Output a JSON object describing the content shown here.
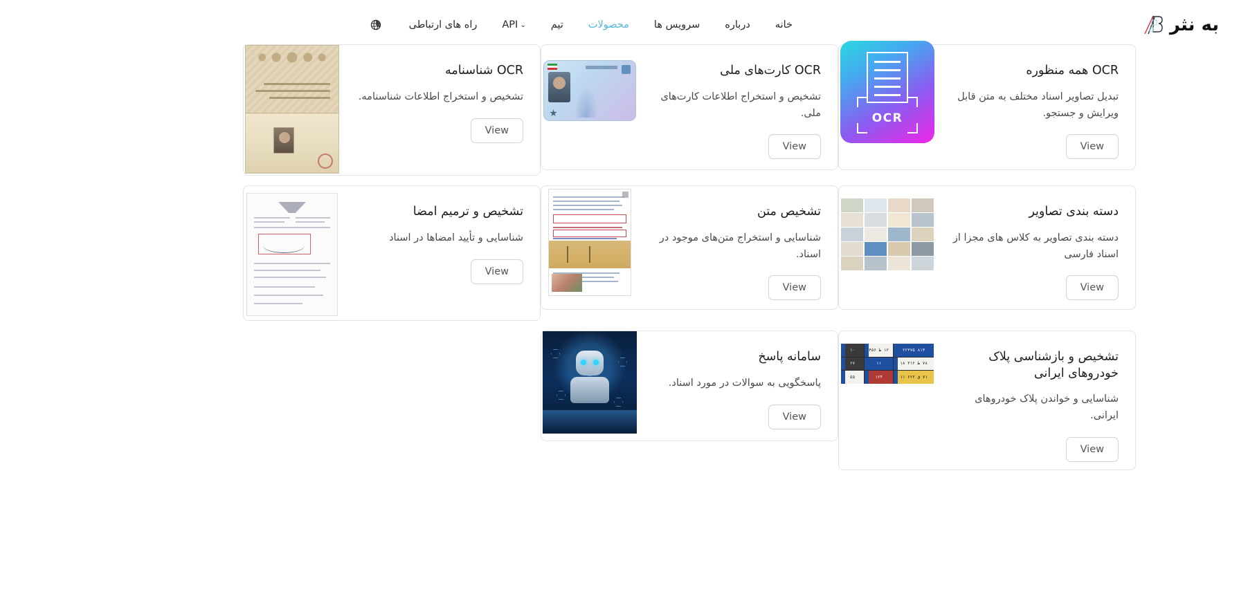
{
  "header": {
    "brand_name": "به نثر",
    "brand_mark": "AB-monogram-logo",
    "nav_items": [
      {
        "label": "خانه",
        "active": false,
        "has_caret": false,
        "name": "home"
      },
      {
        "label": "درباره",
        "active": false,
        "has_caret": false,
        "name": "about"
      },
      {
        "label": "سرویس ها",
        "active": false,
        "has_caret": false,
        "name": "services"
      },
      {
        "label": "محصولات",
        "active": true,
        "has_caret": false,
        "name": "products"
      },
      {
        "label": "تیم",
        "active": false,
        "has_caret": false,
        "name": "team"
      },
      {
        "label": "API",
        "active": false,
        "has_caret": true,
        "name": "api"
      },
      {
        "label": "راه های ارتباطی",
        "active": false,
        "has_caret": false,
        "name": "contact"
      }
    ],
    "caret_glyph": "⌄",
    "language_icon": "globe-icon"
  },
  "colors": {
    "accent": "#52b6d8",
    "text": "#1d1d1d",
    "muted": "#4a4a4a",
    "card_border": "#e4e4e4",
    "button_border": "#d4d4d4",
    "page_background": "#ffffff"
  },
  "common": {
    "view_label": "View"
  },
  "products": [
    {
      "id": "multipurpose-ocr",
      "title": "OCR همه منظوره",
      "description": "تبدیل تصاویر اسناد مختلف به متن قابل ویرایش و جستجو.",
      "button": "View",
      "image_name": "ocr-gradient-tile-thumbnail",
      "row": 1
    },
    {
      "id": "national-card-ocr",
      "title": "OCR کارت‌های ملی",
      "description": "تشخیص و استخراج اطلاعات کارت‌های ملی.",
      "button": "View",
      "image_name": "national-id-card-thumbnail",
      "row": 1
    },
    {
      "id": "birth-certificate-ocr",
      "title": "OCR شناسنامه",
      "description": "تشخیص و استخراج اطلاعات شناسنامه.",
      "button": "View",
      "image_name": "birth-certificate-thumbnail",
      "row": 1
    },
    {
      "id": "image-classification",
      "title": "دسته بندی تصاویر",
      "description": "دسته بندی تصاویر به کلاس های مجزا از اسناد فارسی",
      "button": "View",
      "image_name": "document-image-grid-thumbnail",
      "row": 2
    },
    {
      "id": "text-recognition",
      "title": "تشخیص متن",
      "description": "شناسایی و استخراج متن‌های موجود در اسناد.",
      "button": "View",
      "image_name": "annotated-text-document-thumbnail",
      "row": 2
    },
    {
      "id": "signature-detection",
      "title": "تشخیص و ترمیم امضا",
      "description": "شناسایی و تأیید امضاها در اسناد",
      "button": "View",
      "image_name": "signature-form-thumbnail",
      "row": 2
    },
    {
      "id": "license-plate-recognition",
      "title": "تشخیص و بازشناسی پلاک خودروهای ایرانی",
      "description": "شناسایی و خواندن پلاک خودروهای ایرانی.",
      "button": "View",
      "image_name": "iranian-license-plates-thumbnail",
      "row": 3
    },
    {
      "id": "answer-system",
      "title": "سامانه پاسخ",
      "description": "پاسخگویی به سوالات در مورد اسناد.",
      "button": "View",
      "image_name": "ai-robot-thumbnail",
      "row": 3
    }
  ]
}
